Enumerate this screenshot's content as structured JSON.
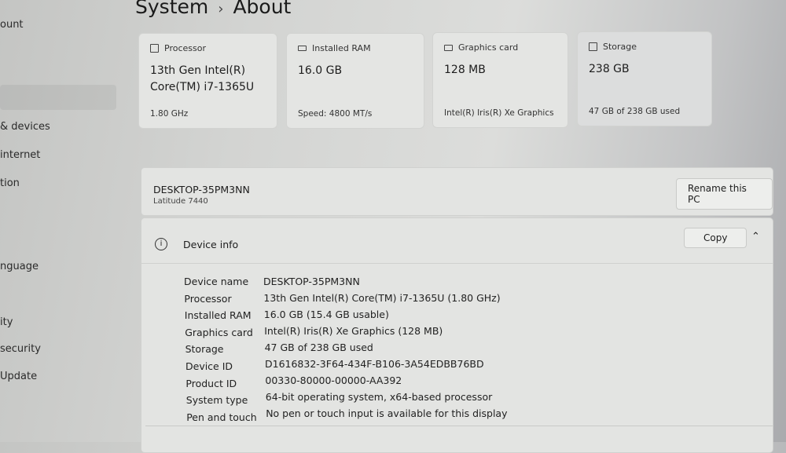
{
  "sidebar": {
    "items": [
      {
        "label": "ount"
      },
      {
        "label": "& devices"
      },
      {
        "label": " internet"
      },
      {
        "label": "tion"
      },
      {
        "label": "nguage"
      },
      {
        "label": "ity"
      },
      {
        "label": " security"
      },
      {
        "label": " Update"
      }
    ]
  },
  "header": {
    "section": "System",
    "separator": "›",
    "page": "About"
  },
  "cards": [
    {
      "label": "Processor",
      "icon": "processor-icon",
      "value": "13th Gen Intel(R) Core(TM) i7-1365U",
      "sub": "1.80 GHz"
    },
    {
      "label": "Installed RAM",
      "icon": "ram-icon",
      "value": "16.0 GB",
      "sub": "Speed: 4800 MT/s"
    },
    {
      "label": "Graphics card",
      "icon": "graphics-card-icon",
      "value": "128 MB",
      "sub": "Intel(R) Iris(R) Xe Graphics"
    },
    {
      "label": "Storage",
      "icon": "storage-icon",
      "value": "238 GB",
      "sub": "47 GB of 238 GB used"
    }
  ],
  "pc": {
    "name": "DESKTOP-35PM3NN",
    "model": "Latitude 7440",
    "rename_label": "Rename this PC"
  },
  "device_info": {
    "title": "Device info",
    "copy_label": "Copy",
    "rows": [
      {
        "k": "Device name",
        "v": "DESKTOP-35PM3NN"
      },
      {
        "k": "Processor",
        "v": "13th Gen Intel(R) Core(TM) i7-1365U (1.80 GHz)"
      },
      {
        "k": "Installed RAM",
        "v": "16.0 GB (15.4 GB usable)"
      },
      {
        "k": "Graphics card",
        "v": "Intel(R) Iris(R) Xe Graphics (128 MB)"
      },
      {
        "k": "Storage",
        "v": "47 GB of 238 GB used"
      },
      {
        "k": "Device ID",
        "v": "D1616832-3F64-434F-B106-3A54EDBB76BD"
      },
      {
        "k": "Product ID",
        "v": "00330-80000-00000-AA392"
      },
      {
        "k": "System type",
        "v": "64-bit operating system, x64-based processor"
      },
      {
        "k": "Pen and touch",
        "v": "No pen or touch input is available for this display"
      }
    ]
  }
}
